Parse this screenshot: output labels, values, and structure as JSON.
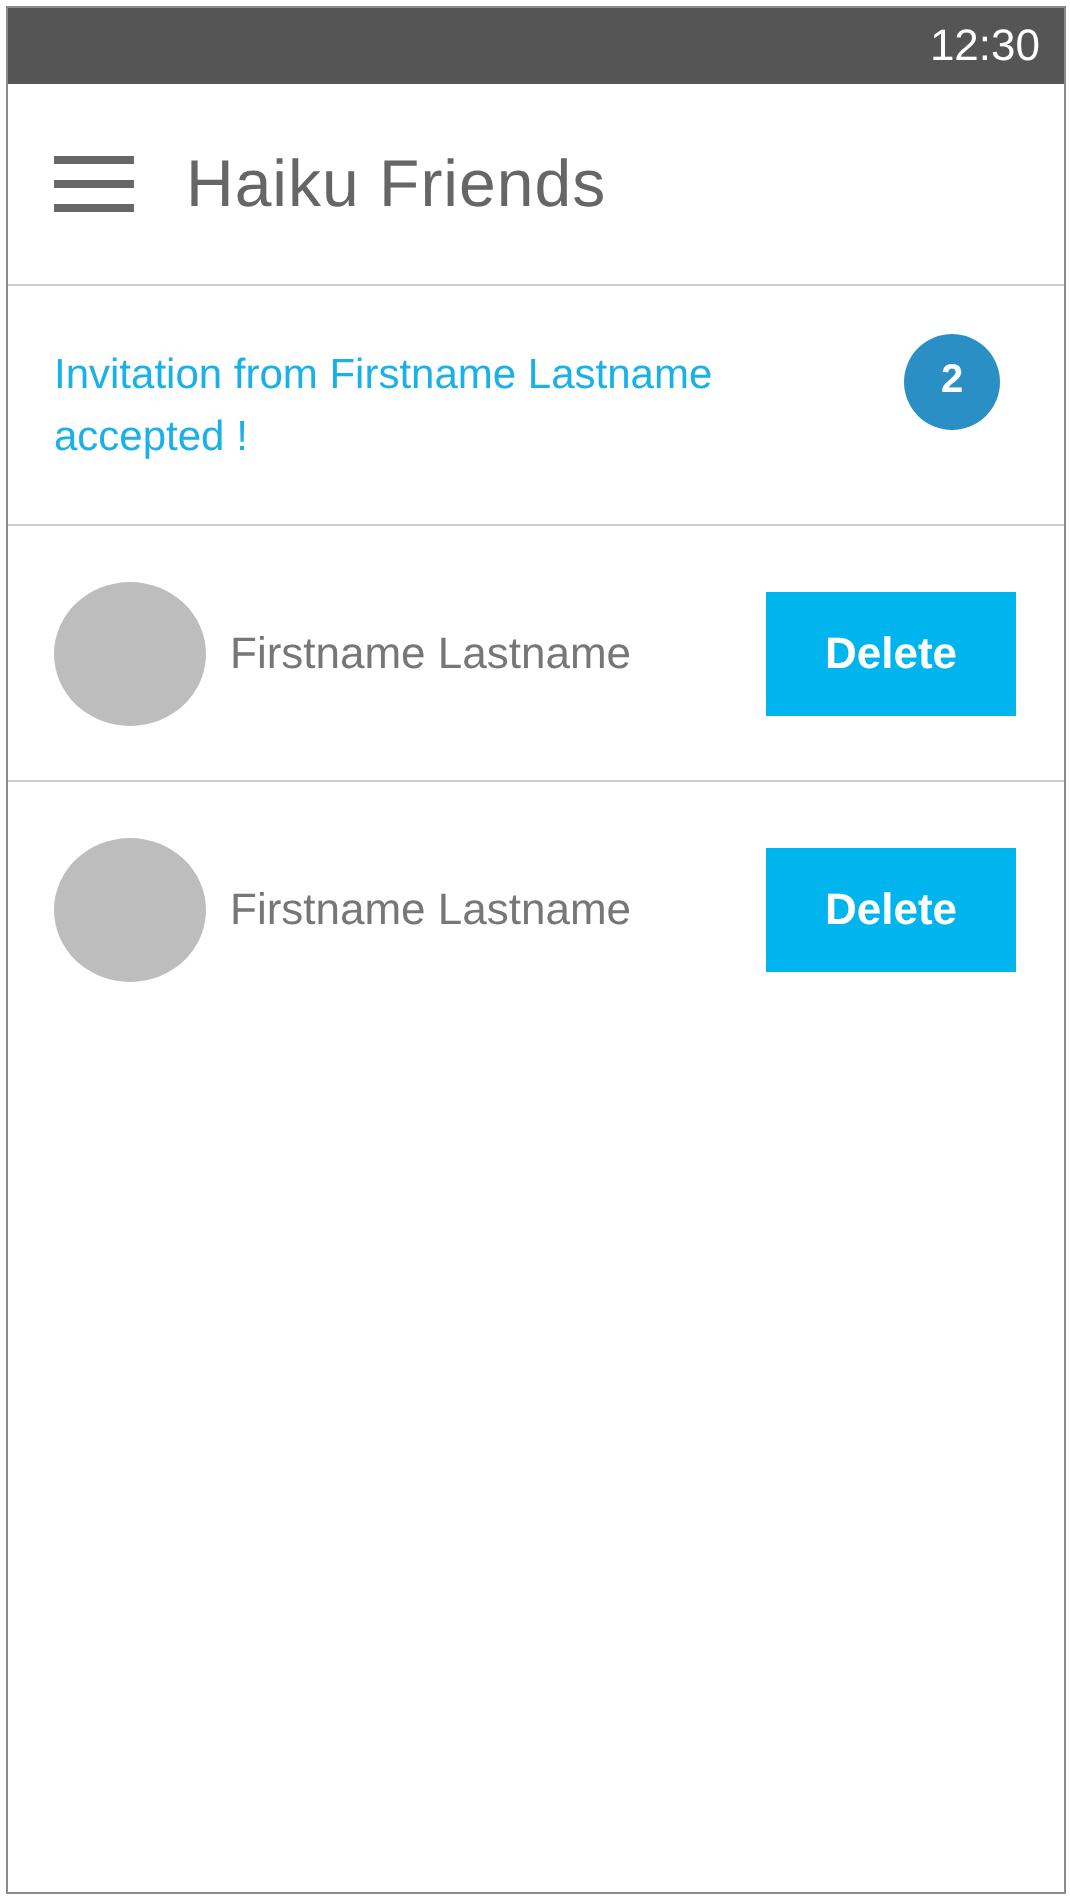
{
  "status_bar": {
    "time": "12:30"
  },
  "header": {
    "title": "Haiku Friends"
  },
  "notification": {
    "text": "Invitation from Firstname Lastname accepted !",
    "badge": "2"
  },
  "friends": [
    {
      "name": "Firstname Lastname",
      "action": "Delete"
    },
    {
      "name": "Firstname Lastname",
      "action": "Delete"
    }
  ]
}
